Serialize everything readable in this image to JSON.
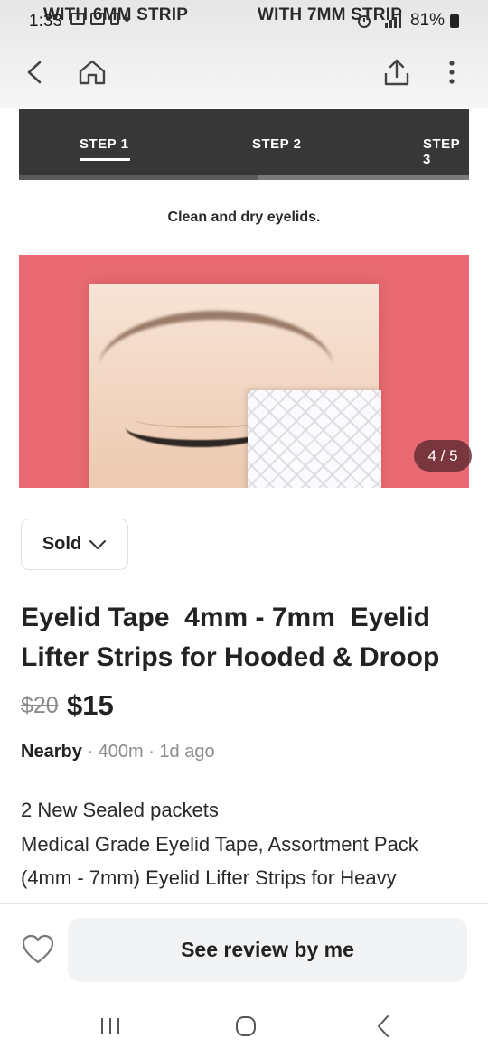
{
  "banner": {
    "left": "WITH 6MM STRIP",
    "right": "WITH 7MM STRIP"
  },
  "status_bar": {
    "time": "1:33",
    "battery": "81%"
  },
  "steps": {
    "tabs": [
      "STEP 1",
      "STEP 2",
      "STEP 3"
    ],
    "active_index": 0,
    "progress_fraction": 0.53
  },
  "gallery": {
    "instruction": "Clean and dry eyelids.",
    "counter": "4 / 5"
  },
  "listing": {
    "status_label": "Sold",
    "title": "Eyelid Tape  4mm - 7mm  Eyelid Lifter Strips for Hooded & Droop",
    "original_price": "$20",
    "price": "$15",
    "location": "Nearby",
    "distance": "400m",
    "posted": "1d ago",
    "description": "2 New Sealed packets\nMedical Grade Eyelid Tape, Assortment Pack (4mm - 7mm) Eyelid Lifter Strips for Heavy Hooded & Droopy Lids, Sensory Free Instant"
  },
  "actions": {
    "review_label": "See review by me"
  },
  "icons": {
    "back": "back-arrow-icon",
    "home": "home-icon",
    "share": "share-icon",
    "more": "more-vertical-icon",
    "heart": "heart-icon",
    "chevron": "chevron-down-icon"
  }
}
